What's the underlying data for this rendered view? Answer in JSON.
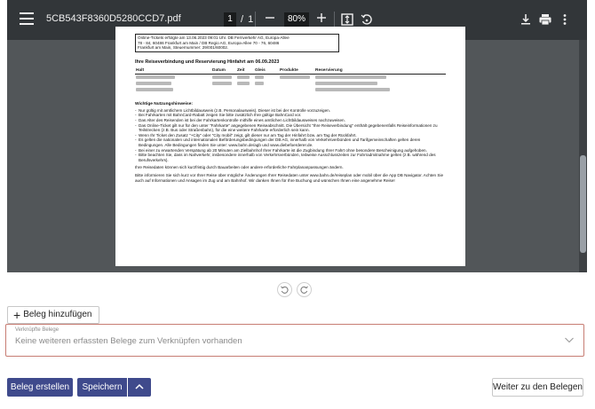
{
  "pdf_viewer": {
    "file_name": "5CB543F8360D5280CCD7.pdf",
    "current_page": "1",
    "page_separator": "/",
    "total_pages": "1",
    "zoom": "80%",
    "icons": {
      "menu": "menu-icon",
      "zoom_out": "minus-icon",
      "zoom_in": "plus-icon",
      "fit": "fit-page-icon",
      "rotate": "rotate-icon",
      "download": "download-icon",
      "print": "print-icon",
      "more": "more-vert-icon"
    }
  },
  "document": {
    "box_lines": [
      "Online-Tickets erfolgte am 13.06.2023 09:01 Uhr. DB Fernverkehr AG, Europa-Allee",
      "78 - 84, 60486 Frankfurt am Main / DB Regio AG, Europa-Allee 70 - 76, 60486",
      "Frankfurt am Main, Steuernummer: 29/001/60002."
    ],
    "section_title": "Ihre Reiseverbindung und Reservierung Hinfahrt am 06.09.2023",
    "table_headers": [
      "Halt",
      "Datum",
      "Zeit",
      "Gleis",
      "Produkte",
      "Reservierung"
    ],
    "hints_title": "Wichtige Nutzungshinweise:",
    "hints": [
      "Nur gültig mit amtlichem Lichtbildausweis (z.B. Personalausweis). Dieser ist bei der Kontrolle vorzuzeigen.",
      "Bei Fahrkarten mit BahnCard-Rabatt zeigen Sie bitte zusätzlich Ihre gültige BahnCard vor.",
      "Das Alter des Reisenden ist bei der Fahrkartenkontrolle mithilfe eines amtlichen Lichtbildausweises nachzuweisen.",
      "Das Online-Ticket gilt nur für den unter \"Fahrkarte\" angegebenen Reiseabschnitt. Die Übersicht \"Ihre Reiseverbindung\" enthält gegebenenfalls Reiseinformationen zu Teilstrecken (z.B. Bus oder Straßenbahn), für die eine weitere Fahrkarte erforderlich sein kann.",
      "Wenn Ihr Ticket den Zusatz \"+City\" oder \"City mobil\" zeigt, gilt dieser nur am Tag der Hinfahrt bzw. am Tag der Rückfahrt.",
      "Es gelten die nationalen und internationalen Beförderungsbedingungen der DB AG, innerhalb von Verkehrsverbünden und Tarifgemeinschaften gelten deren Bedingungen. Alle Bedingungen finden Sie unter: www.bahn.de/agb und www.diebefoerderer.de.",
      "Bei einer zu erwartenden Verspätung ab 20 Minuten am Zielbahnhof Ihrer Fahrkarte ist die Zugbindung Ihrer Fahrt ohne besondere Bescheinigung aufgehoben.",
      "Bitte beachten Sie, dass im Nahverkehr, insbesondere innerhalb von Verkehrsverbünden, teilweise Ausschlusszeiten zur Fahrradmitnahme gelten (z.B. während des Berufsverkehrs)."
    ],
    "para1": "Ihre Reisedaten können sich kurzfristig durch Bauarbeiten oder andere erforderliche Fahrplananpassungen ändern.",
    "para2": "Bitte informieren Sie sich kurz vor Ihrer Reise über mögliche Änderungen Ihrer Reisedaten unter www.bahn.de/reiseplan oder mobil über die App DB Navigator. Achten Sie auch auf Informationen und Ansagen im Zug und am Bahnhof. Wir danken Ihnen für Ihre Buchung und wünschen Ihnen eine angenehme Reise!"
  },
  "rotate_controls": {
    "undo_icon": "rotate-left-icon",
    "redo_icon": "rotate-right-icon"
  },
  "add_receipt_button": {
    "icon": "plus-icon",
    "label": "Beleg hinzufügen"
  },
  "linked_receipts": {
    "label": "Verknüpfte Belege",
    "value": "Keine weiteren erfassten Belege zum Verknüpfen vorhanden",
    "icon": "chevron-down-icon",
    "border_color": "#c77d73"
  },
  "footer": {
    "create_label": "Beleg erstellen",
    "save_label": "Speichern",
    "save_menu_icon": "chevron-up-icon",
    "next_label": "Weiter zu den Belegen",
    "primary_color": "#3f4a8c"
  }
}
